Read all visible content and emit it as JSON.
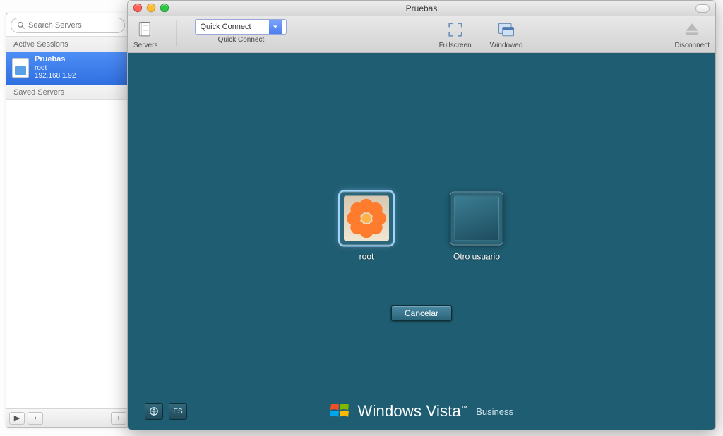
{
  "sidebar": {
    "search_placeholder": "Search Servers",
    "active_header": "Active Sessions",
    "saved_header": "Saved Servers",
    "session": {
      "name": "Pruebas",
      "user": "root",
      "ip": "192.168.1.92"
    },
    "footer": {
      "play": "▶",
      "info": "i",
      "add": "+"
    }
  },
  "window": {
    "title": "Pruebas",
    "toolbar": {
      "servers": "Servers",
      "quick_connect_label": "Quick Connect",
      "quick_connect_value": "Quick Connect",
      "fullscreen": "Fullscreen",
      "windowed": "Windowed",
      "disconnect": "Disconnect"
    }
  },
  "remote": {
    "users": {
      "root": "root",
      "other": "Otro usuario"
    },
    "cancel": "Cancelar",
    "lang": "ES",
    "brand_product_a": "Windows",
    "brand_product_b": "Vista",
    "brand_tm": "™",
    "brand_edition": "Business"
  }
}
